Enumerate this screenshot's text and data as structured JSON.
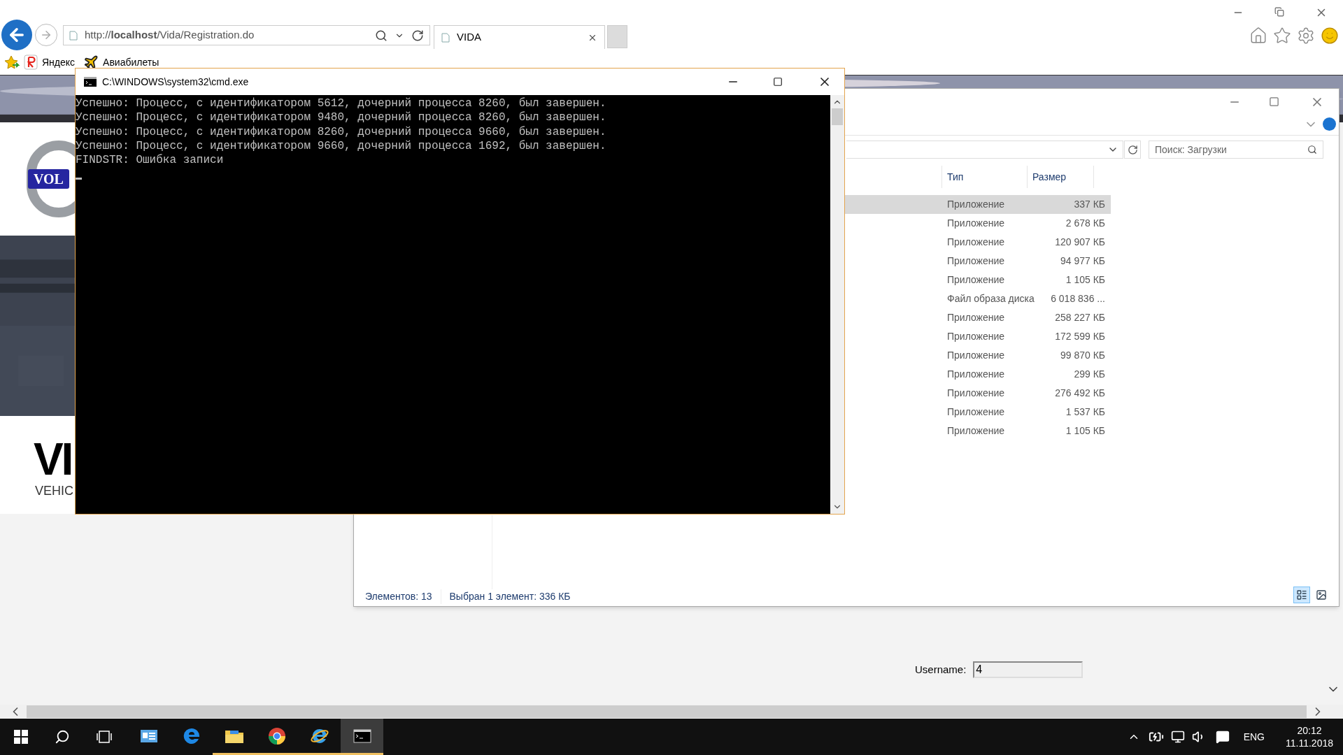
{
  "browser": {
    "address": "http://**localhost**/Vida/Registration.do",
    "tab": {
      "title": "VIDA",
      "selected": true
    },
    "favorites": [
      "Яндекс",
      "Авиабилеты"
    ]
  },
  "page": {
    "vida": {
      "logo_text": "VOL",
      "title": "VI",
      "subtitle": "VEHIC"
    },
    "username": {
      "label": "Username:",
      "value": "4"
    }
  },
  "explorer": {
    "search": {
      "placeholder": "Поиск: Загрузки"
    },
    "columns": [
      "Тип",
      "Размер"
    ],
    "rows": [
      {
        "type": "Приложение",
        "size": "337 КБ",
        "selected": true
      },
      {
        "type": "Приложение",
        "size": "2 678 КБ",
        "selected": false
      },
      {
        "type": "Приложение",
        "size": "120 907 КБ",
        "selected": false
      },
      {
        "type": "Приложение",
        "size": "94 977 КБ",
        "selected": false
      },
      {
        "type": "Приложение",
        "size": "1 105 КБ",
        "selected": false
      },
      {
        "type": "Файл образа диска",
        "size": "6 018 836 ...",
        "selected": false
      },
      {
        "type": "Приложение",
        "size": "258 227 КБ",
        "selected": false
      },
      {
        "type": "Приложение",
        "size": "172 599 КБ",
        "selected": false
      },
      {
        "type": "Приложение",
        "size": "99 870 КБ",
        "selected": false
      },
      {
        "type": "Приложение",
        "size": "299 КБ",
        "selected": false
      },
      {
        "type": "Приложение",
        "size": "276 492 КБ",
        "selected": false
      },
      {
        "type": "Приложение",
        "size": "1 537 КБ",
        "selected": false
      },
      {
        "type": "Приложение",
        "size": "1 105 КБ",
        "selected": false
      }
    ],
    "status": [
      "Элементов: 13",
      "Выбран 1 элемент: 336 КБ"
    ],
    "views": [
      {
        "kind": "details",
        "selected": true
      },
      {
        "kind": "tiles",
        "selected": false
      }
    ]
  },
  "cmd": {
    "title": "C:\\WINDOWS\\system32\\cmd.exe",
    "lines": [
      "Успешно: Процесс, с идентификатором 5612, дочерний процесса 8260, был завершен.",
      "Успешно: Процесс, с идентификатором 9480, дочерний процесса 8260, был завершен.",
      "Успешно: Процесс, с идентификатором 8260, дочерний процесса 9660, был завершен.",
      "Успешно: Процесс, с идентификатором 9660, дочерний процесса 1692, был завершен.",
      "FINDSTR: Ошибка записи"
    ]
  },
  "taskbar": {
    "apps": [
      {
        "kind": "contacts",
        "running": false,
        "active": false
      },
      {
        "kind": "edge",
        "running": false,
        "active": false
      },
      {
        "kind": "folder",
        "running": true,
        "active": false
      },
      {
        "kind": "chrome",
        "running": true,
        "active": false
      },
      {
        "kind": "ie",
        "running": true,
        "active": false
      },
      {
        "kind": "console",
        "running": true,
        "active": true
      }
    ],
    "language": "ENG",
    "time": "20:12",
    "date": "11.11.2018"
  }
}
